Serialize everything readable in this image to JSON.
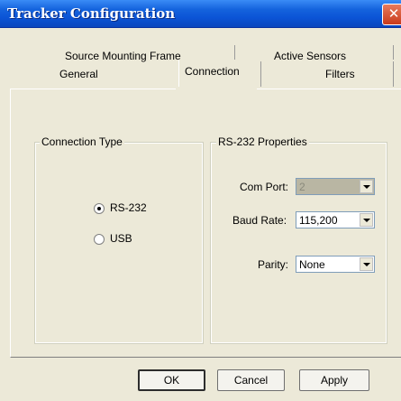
{
  "window": {
    "title": "Tracker Configuration",
    "close_glyph": "✕"
  },
  "tabs": {
    "row_back": [
      "Source Mounting Frame",
      "Active Sensors"
    ],
    "row_front": [
      "General",
      "Connection",
      "Filters"
    ],
    "active": "Connection"
  },
  "connection_type": {
    "title": "Connection Type",
    "options": [
      {
        "label": "RS-232",
        "selected": true
      },
      {
        "label": "USB",
        "selected": false
      }
    ]
  },
  "rs232": {
    "title": "RS-232 Properties",
    "com_port": {
      "label": "Com Port:",
      "value": "2",
      "disabled": true
    },
    "baud_rate": {
      "label": "Baud Rate:",
      "value": "115,200"
    },
    "parity": {
      "label": "Parity:",
      "value": "None"
    }
  },
  "buttons": {
    "ok": "OK",
    "cancel": "Cancel",
    "apply": "Apply"
  },
  "icons": {
    "close": "close-icon",
    "dropdown": "chevron-down-icon",
    "radio": "radio-icon"
  },
  "colors": {
    "titlebar": "#0b54d6",
    "close": "#c93b1c",
    "dialog": "#ece9d8"
  }
}
